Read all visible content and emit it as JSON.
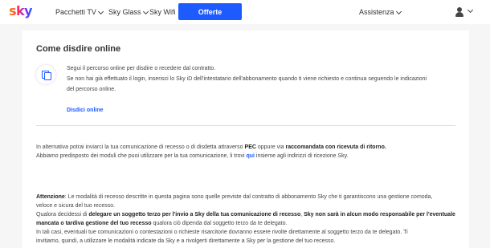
{
  "nav": {
    "logo": "sky",
    "links": [
      "Pacchetti TV",
      "Sky Glass",
      "Sky Wifi"
    ],
    "cta": "Offerte",
    "assistenza": "Assistenza"
  },
  "section": {
    "title": "Come disdire online",
    "intro_line1": "Segui il percorso online per disdire o recedere dal contratto.",
    "intro_line2": "Se non hai già effettuato il login, inserisci lo Sky iD dell'intestatario dell'abbonamento quando ti viene richiesto e continua seguendo le indicazioni",
    "intro_line3": "del percorso online.",
    "link": "Disdici online"
  },
  "alt": {
    "l1_a": "In alternativa potrai inviarci la tua comunicazione di recesso o di disdetta attraverso ",
    "l1_b": "PEC",
    "l1_c": " oppure via ",
    "l1_d": "raccomandata con ricevuta di ritorno.",
    "l2_a": "Abbiamo predisposto dei moduli che puoi utilizzare per la tua comunicazione, li trovi ",
    "l2_link": "qui",
    "l2_b": " insieme agli indirizzi di ricezione Sky."
  },
  "note": {
    "label": "Attenzione",
    "l1": ": Le modalità di recesso descritte in questa pagina sono quelle previste dal contratto di abbonamento Sky che ti garantiscono una gestione comoda,",
    "l2": "veloce e sicura del tuo recesso.",
    "l3_a": "Qualora decidessi di ",
    "l3_b": "delegare un soggetto terzo per l'invio a Sky della tua comunicazione di recesso",
    "l3_c": ", ",
    "l3_d": "Sky non sarà in alcun modo responsabile per l'eventuale",
    "l4_a": "mancata o tardiva gestione del tuo recesso",
    "l4_b": " qualora ciò dipenda dal soggetto terzo da te delegato.",
    "l5": "In tali casi, eventuali tue comunicazioni o contestazioni o richieste risarcitorie dovranno essere rivolte direttamente al soggetto terzo da te delegato. Ti",
    "l6": "invitiamo, quindi, a utilizzare le modalità indicate da Sky e a rivolgerti direttamente a Sky per la gestione del tuo recesso."
  }
}
